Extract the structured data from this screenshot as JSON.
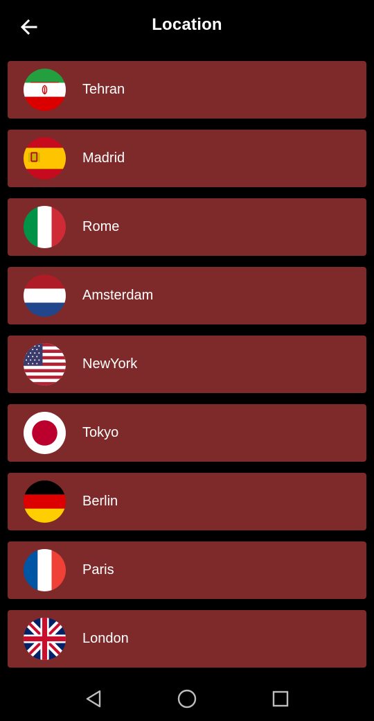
{
  "header": {
    "title": "Location",
    "back_icon": "arrow-left-icon"
  },
  "locations": [
    {
      "city": "Tehran",
      "flag": "iran-flag-icon"
    },
    {
      "city": "Madrid",
      "flag": "spain-flag-icon"
    },
    {
      "city": "Rome",
      "flag": "italy-flag-icon"
    },
    {
      "city": "Amsterdam",
      "flag": "netherlands-flag-icon"
    },
    {
      "city": "NewYork",
      "flag": "usa-flag-icon"
    },
    {
      "city": "Tokyo",
      "flag": "japan-flag-icon"
    },
    {
      "city": "Berlin",
      "flag": "germany-flag-icon"
    },
    {
      "city": "Paris",
      "flag": "france-flag-icon"
    },
    {
      "city": "London",
      "flag": "uk-flag-icon"
    }
  ],
  "navbar": {
    "back_icon": "nav-back-triangle-icon",
    "home_icon": "nav-home-circle-icon",
    "recent_icon": "nav-recent-square-icon"
  },
  "colors": {
    "background": "#000000",
    "item_background": "#7f2a2a",
    "text": "#ffffff"
  }
}
